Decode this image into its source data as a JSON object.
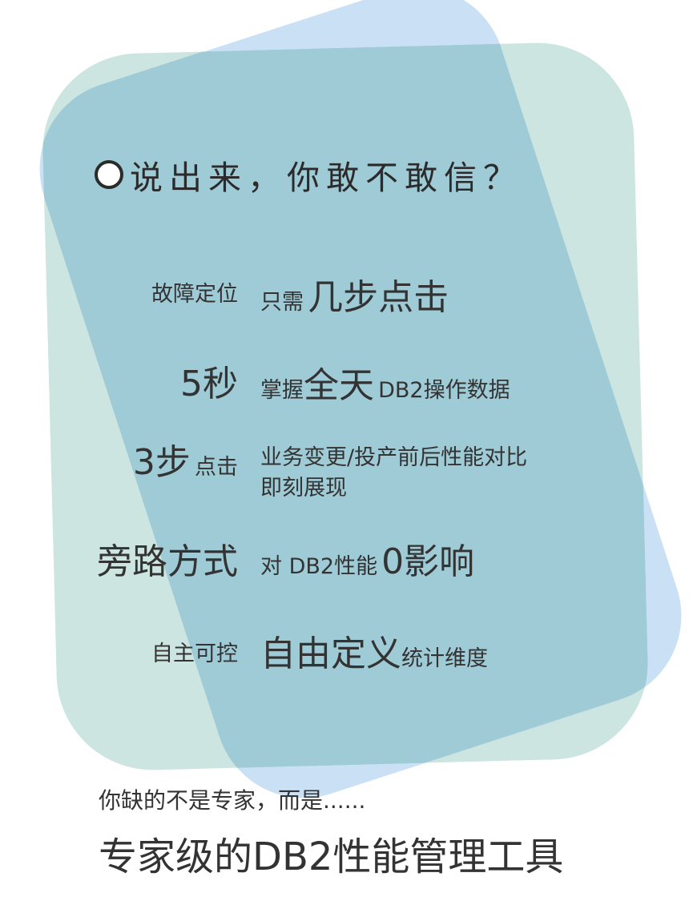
{
  "heading": "说出来，你敢不敢信？",
  "rows": [
    {
      "label": "故障定位",
      "value_small": "只需",
      "value_big": "几步点击"
    },
    {
      "label": "5秒",
      "value_small1": "掌握",
      "value_big": "全天",
      "value_small2": "DB2操作数据"
    },
    {
      "label_big": "3步",
      "label_small": "点击",
      "value_line1": "业务变更/投产前后性能对比",
      "value_line2": "即刻展现"
    },
    {
      "label": "旁路方式",
      "value_small": "对 DB2性能",
      "value_big": "0影响"
    },
    {
      "label": "自主可控",
      "value_big": "自由定义",
      "value_small": "统计维度"
    }
  ],
  "footer": {
    "line1": "你缺的不是专家，而是......",
    "line2": "专家级的DB2性能管理工具"
  },
  "colors": {
    "green_card": "#cde5e1",
    "blue_card": "#8abae6",
    "overlap": "#9fcbd6",
    "text": "#333333"
  }
}
